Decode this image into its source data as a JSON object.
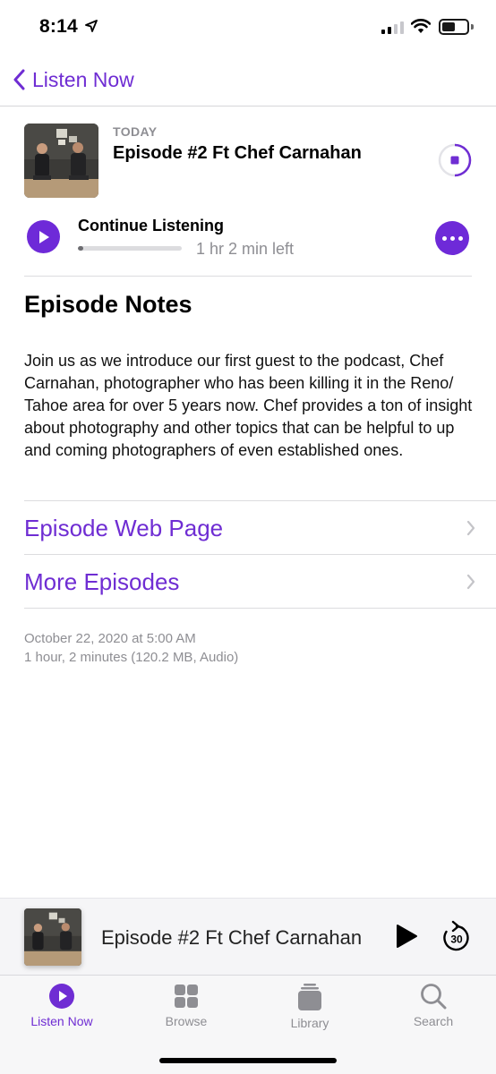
{
  "status_bar": {
    "time": "8:14"
  },
  "nav": {
    "back_label": "Listen Now"
  },
  "episode": {
    "date_label": "TODAY",
    "title": "Episode #2 Ft Chef Carnahan",
    "continue_label": "Continue Listening",
    "time_left": "1 hr 2 min left",
    "progress": 0.05
  },
  "notes": {
    "heading": "Episode Notes",
    "body": "Join us as we introduce our first guest to the podcast, Chef Carnahan, photographer who has been killing it in the Reno/ Tahoe area for over 5 years now. Chef provides a ton of insight about photography and other topics that can be helpful to up and coming photographers of even established ones."
  },
  "links": [
    {
      "label": "Episode Web Page"
    },
    {
      "label": "More Episodes"
    }
  ],
  "meta": {
    "published": "October 22, 2020 at 5:00 AM",
    "details": "1 hour, 2 minutes (120.2 MB, Audio)"
  },
  "mini_player": {
    "title": "Episode #2 Ft Chef Carnahan",
    "skip_seconds": "30"
  },
  "tabs": [
    {
      "label": "Listen Now",
      "icon": "listen-now-icon",
      "active": true
    },
    {
      "label": "Browse",
      "icon": "browse-grid-icon",
      "active": false
    },
    {
      "label": "Library",
      "icon": "library-stack-icon",
      "active": false
    },
    {
      "label": "Search",
      "icon": "search-icon",
      "active": false
    }
  ],
  "colors": {
    "accent": "#6f2dd3",
    "secondary_text": "#8e8e93"
  }
}
